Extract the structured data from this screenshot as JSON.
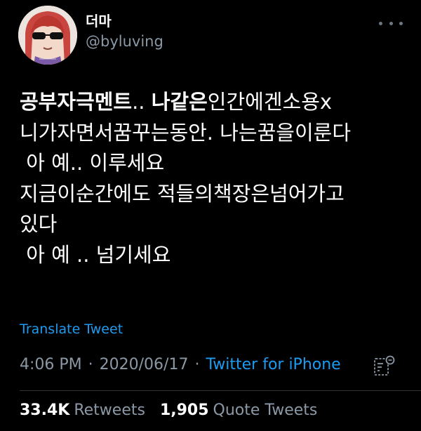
{
  "author": {
    "display_name": "더마",
    "handle": "@byluving"
  },
  "tweet": {
    "lines": [
      [
        {
          "text": "공부자극멘트",
          "bold": true
        },
        {
          "text": ".. ",
          "bold": false
        },
        {
          "text": "나같은",
          "bold": true
        },
        {
          "text": "인간에겐소용x",
          "bold": false
        }
      ],
      [
        {
          "text": "니가자면서꿈꾸는동안. 나는꿈을이룬다",
          "bold": false
        }
      ],
      [
        {
          "text": " 아 예.. 이루세요",
          "bold": false
        }
      ],
      [
        {
          "text": "지금이순간에도 적들의책장은넘어가고",
          "bold": false
        }
      ],
      [
        {
          "text": "있다",
          "bold": false
        }
      ],
      [
        {
          "text": " 아 예 .. 넘기세요",
          "bold": false
        }
      ]
    ]
  },
  "translate_label": "Translate Tweet",
  "meta": {
    "time": "4:06 PM",
    "separator": "·",
    "date": "2020/06/17",
    "source": "Twitter for iPhone"
  },
  "stats": {
    "retweets_count": "33.4K",
    "retweets_label": "Retweets",
    "quotes_count": "1,905",
    "quotes_label": "Quote Tweets"
  },
  "icons": {
    "more": "more-horizontal-icon",
    "analytics": "analytics-icon"
  },
  "colors": {
    "background": "#000000",
    "text": "#ffffff",
    "secondary": "#8b98a5",
    "link": "#1d9bf0"
  }
}
